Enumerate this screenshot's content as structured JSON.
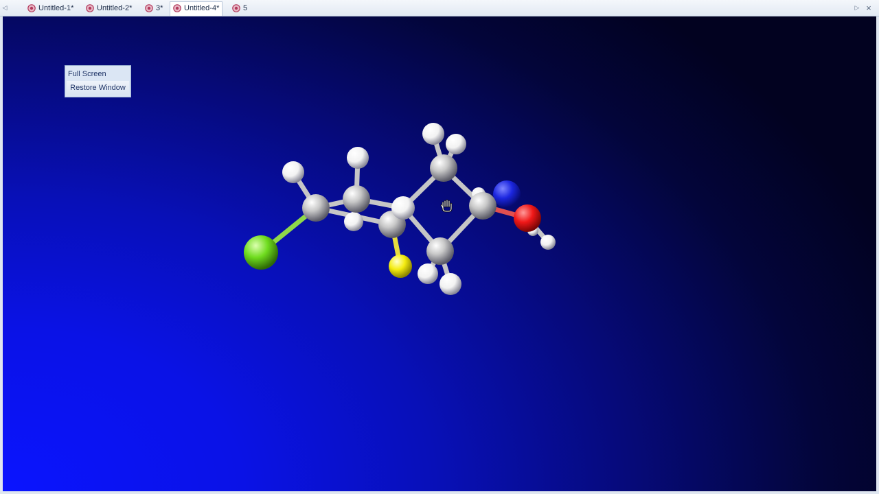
{
  "tabs": [
    {
      "label": "Untitled-1*",
      "active": false,
      "icon": "document-icon"
    },
    {
      "label": "Untitled-2*",
      "active": false,
      "icon": "document-icon"
    },
    {
      "label": "3*",
      "active": false,
      "icon": "document-icon"
    },
    {
      "label": "Untitled-4*",
      "active": true,
      "icon": "document-icon"
    },
    {
      "label": "5",
      "active": false,
      "icon": "document-icon"
    }
  ],
  "nav": {
    "left_icon": "scroll-left-icon",
    "right_icon": "scroll-right-icon",
    "close_icon": "close-icon",
    "close_label": "×"
  },
  "fullscreen_panel": {
    "title": "Full Screen",
    "restore_label": "Restore Window"
  },
  "molecule": {
    "colors": {
      "carbon": "#c8c8c8",
      "hydrogen": "#f2f2f2",
      "nitrogen": "#1c27e0",
      "oxygen": "#f01818",
      "chlorine": "#6fdc1e",
      "sulfur": "#f4ec10",
      "bond": "#c6c6c6"
    },
    "atoms": [
      "C",
      "C",
      "C",
      "C",
      "C",
      "C",
      "C",
      "N",
      "O",
      "H",
      "Cl",
      "S",
      "H",
      "H",
      "H",
      "H",
      "H",
      "H",
      "H",
      "H",
      "H",
      "H"
    ]
  },
  "cursor_icon": "hand-cursor-icon",
  "viewport_colors": {
    "bottom_left": "#0a14ff",
    "top_right": "#020220"
  }
}
